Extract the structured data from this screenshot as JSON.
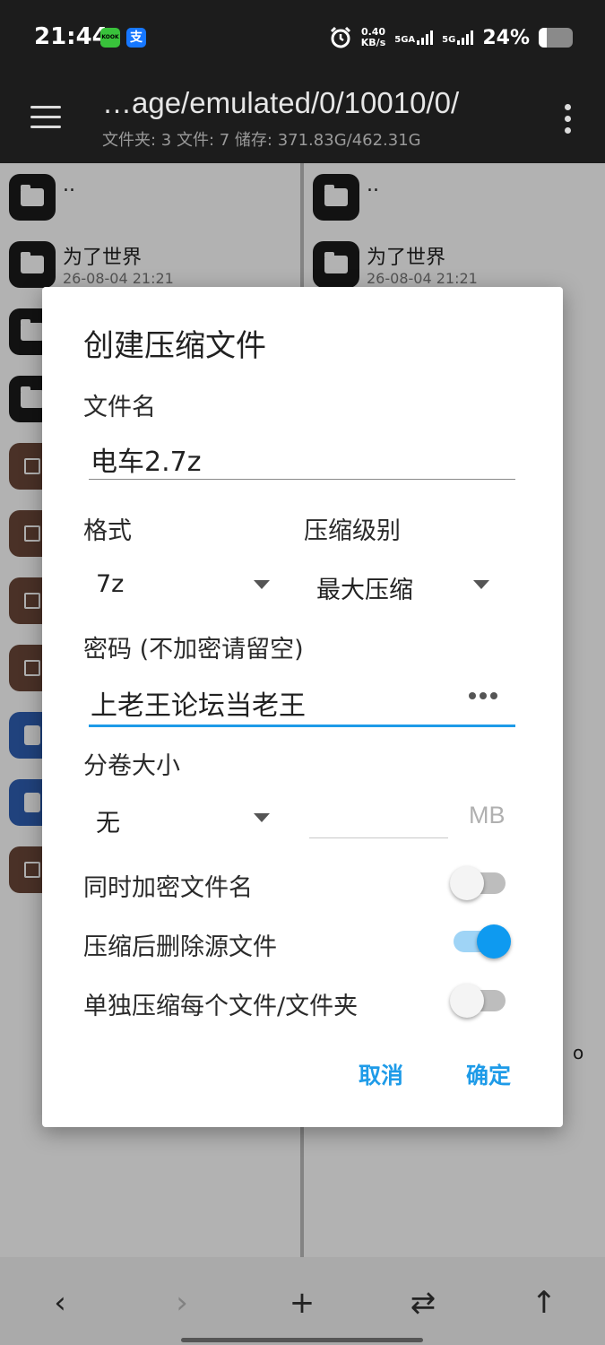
{
  "status_bar": {
    "time": "21:44",
    "app_icon_1": "KOOK",
    "app_icon_2": "支",
    "speed_value": "0.40",
    "speed_unit": "KB/s",
    "net1": "5GA",
    "net2": "5G",
    "battery": "24%",
    "battery_level": 0.24
  },
  "appbar": {
    "path": "…age/emulated/0/10010/0/",
    "summary": "文件夹: 3  文件: 7  储存: 371.83G/462.31G"
  },
  "left_pane": {
    "rows": [
      {
        "type": "folder",
        "name": "..",
        "date": ""
      },
      {
        "type": "folder",
        "name": "为了世界",
        "date": "26-08-04 21:21"
      },
      {
        "type": "folder",
        "name": "",
        "date": ""
      },
      {
        "type": "folder",
        "name": "",
        "date": ""
      },
      {
        "type": "archive",
        "name": "",
        "date": ""
      },
      {
        "type": "archive",
        "name": "",
        "date": ""
      },
      {
        "type": "archive",
        "name": "",
        "date": ""
      },
      {
        "type": "archive",
        "name": "",
        "date": ""
      },
      {
        "type": "doc",
        "name": "",
        "date": ""
      },
      {
        "type": "doc",
        "name": "",
        "date": ""
      },
      {
        "type": "archive",
        "name": "",
        "date": ""
      }
    ]
  },
  "right_pane": {
    "rows": [
      {
        "type": "folder",
        "name": "..",
        "date": ""
      },
      {
        "type": "folder",
        "name": "为了世界",
        "date": "26-08-04 21:21"
      }
    ],
    "fragment": "o"
  },
  "dialog": {
    "title": "创建压缩文件",
    "filename_label": "文件名",
    "filename_value": "电车2.7z",
    "format_label": "格式",
    "format_value": "7z",
    "level_label": "压缩级别",
    "level_value": "最大压缩",
    "password_label": "密码 (不加密请留空)",
    "password_value": "上老王论坛当老王",
    "volume_label": "分卷大小",
    "volume_value": "无",
    "volume_size_value": "",
    "volume_unit": "MB",
    "toggles": [
      {
        "label": "同时加密文件名",
        "on": false
      },
      {
        "label": "压缩后删除源文件",
        "on": true
      },
      {
        "label": "单独压缩每个文件/文件夹",
        "on": false
      }
    ],
    "cancel_label": "取消",
    "ok_label": "确定",
    "accent_color": "#1e9be8"
  },
  "bottom_bar": {
    "back_icon": "‹",
    "forward_icon": "›",
    "add_icon": "+",
    "swap_icon": "⇄",
    "up_icon": "↑"
  }
}
